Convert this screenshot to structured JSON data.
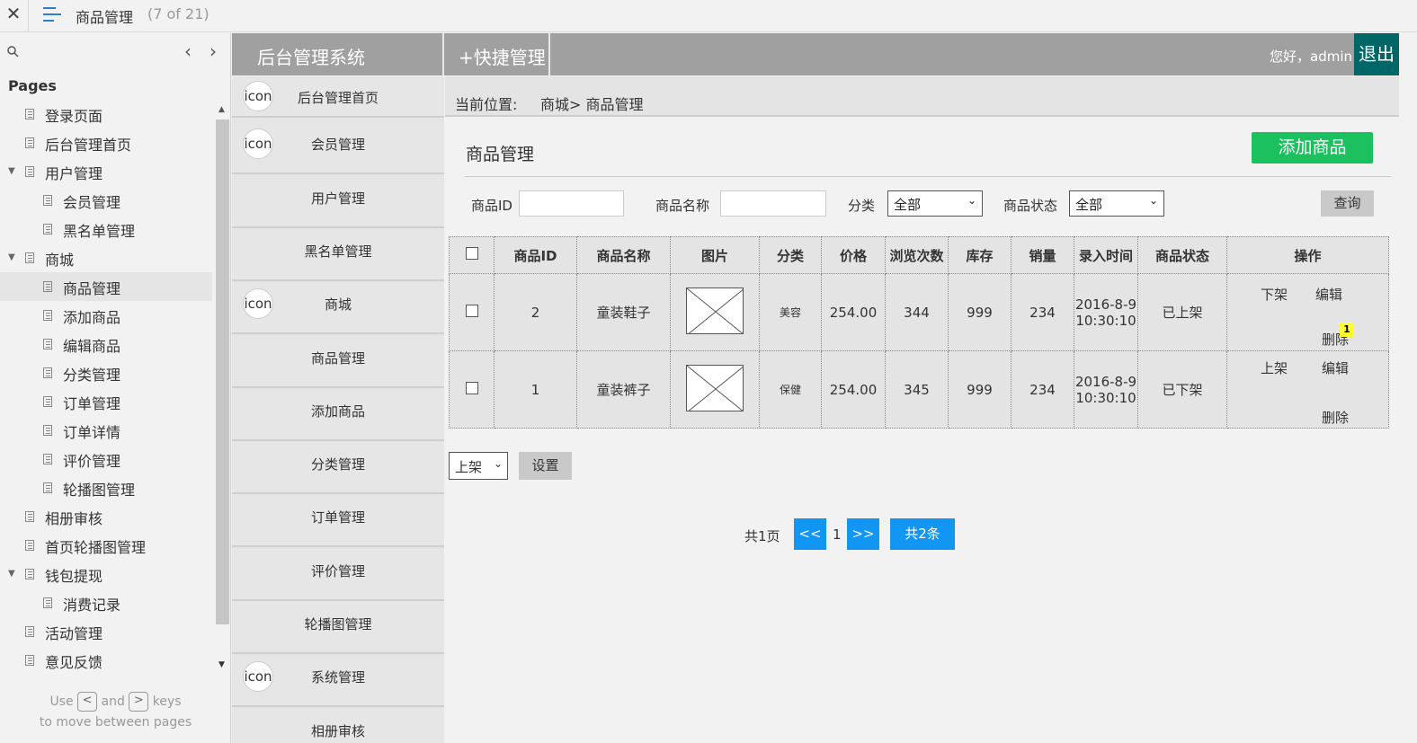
{
  "topbar": {
    "close": "✕",
    "title": "商品管理",
    "count": "(7 of 21)"
  },
  "sidebar": {
    "prev": "‹",
    "next": "›",
    "heading": "Pages",
    "items": [
      {
        "label": "登录页面",
        "level": 1,
        "expand": false
      },
      {
        "label": "后台管理首页",
        "level": 1,
        "expand": false
      },
      {
        "label": "用户管理",
        "level": 1,
        "expand": true
      },
      {
        "label": "会员管理",
        "level": 2,
        "expand": false
      },
      {
        "label": "黑名单管理",
        "level": 2,
        "expand": false
      },
      {
        "label": "商城",
        "level": 1,
        "expand": true
      },
      {
        "label": "商品管理",
        "level": 2,
        "expand": false,
        "selected": true
      },
      {
        "label": "添加商品",
        "level": 2,
        "expand": false
      },
      {
        "label": "编辑商品",
        "level": 2,
        "expand": false
      },
      {
        "label": "分类管理",
        "level": 2,
        "expand": false
      },
      {
        "label": "订单管理",
        "level": 2,
        "expand": false
      },
      {
        "label": "订单详情",
        "level": 2,
        "expand": false
      },
      {
        "label": "评价管理",
        "level": 2,
        "expand": false
      },
      {
        "label": "轮播图管理",
        "level": 2,
        "expand": false
      },
      {
        "label": "相册审核",
        "level": 1,
        "expand": false
      },
      {
        "label": "首页轮播图管理",
        "level": 1,
        "expand": false
      },
      {
        "label": "钱包提现",
        "level": 1,
        "expand": true
      },
      {
        "label": "消费记录",
        "level": 2,
        "expand": false
      },
      {
        "label": "活动管理",
        "level": 1,
        "expand": false
      },
      {
        "label": "意见反馈",
        "level": 1,
        "expand": false
      }
    ],
    "hint_use": "Use",
    "hint_and": "and",
    "hint_keys": "keys",
    "hint_line2": "to move between pages",
    "key_prev": "<",
    "key_next": ">"
  },
  "header": {
    "app_title": "后台管理系统",
    "quick": "+快捷管理",
    "greeting": "您好，admin",
    "logout": "退出"
  },
  "sidenav": [
    {
      "label": "后台管理首页",
      "icon": "icon"
    },
    {
      "label": "会员管理",
      "icon": "icon"
    },
    {
      "label": "用户管理",
      "icon": ""
    },
    {
      "label": "黑名单管理",
      "icon": ""
    },
    {
      "label": "商城",
      "icon": "icon"
    },
    {
      "label": "商品管理",
      "icon": ""
    },
    {
      "label": "添加商品",
      "icon": ""
    },
    {
      "label": "分类管理",
      "icon": ""
    },
    {
      "label": "订单管理",
      "icon": ""
    },
    {
      "label": "评价管理",
      "icon": ""
    },
    {
      "label": "轮播图管理",
      "icon": ""
    },
    {
      "label": "系统管理",
      "icon": "icon"
    },
    {
      "label": "相册审核",
      "icon": ""
    }
  ],
  "breadcrumb": {
    "label": "当前位置:",
    "path": "商城> 商品管理"
  },
  "main": {
    "title": "商品管理",
    "add_button": "添加商品",
    "filters": {
      "id_label": "商品ID",
      "name_label": "商品名称",
      "category_label": "分类",
      "category_value": "全部",
      "status_label": "商品状态",
      "status_value": "全部",
      "query": "查询"
    },
    "table": {
      "headers": [
        "商品ID",
        "商品名称",
        "图片",
        "分类",
        "价格",
        "浏览次数",
        "库存",
        "销量",
        "录入时间",
        "商品状态",
        "操作"
      ],
      "rows": [
        {
          "id": "2",
          "name": "童装鞋子",
          "category": "美容",
          "price": "254.00",
          "views": "344",
          "stock": "999",
          "sales": "234",
          "date": "2016-8-9",
          "time": "10:30:10",
          "status": "已上架",
          "op1": "下架",
          "op2": "编辑",
          "op3": "删除",
          "badge": "1"
        },
        {
          "id": "1",
          "name": "童装裤子",
          "category": "保健",
          "price": "254.00",
          "views": "345",
          "stock": "999",
          "sales": "234",
          "date": "2016-8-9",
          "time": "10:30:10",
          "status": "已下架",
          "op1": "上架",
          "op2": "编辑",
          "op3": "删除",
          "badge": ""
        }
      ]
    },
    "bulk_select": "上架",
    "set_button": "设置",
    "pagination": {
      "total_pages": "共1页",
      "prev": "<<",
      "current": "1",
      "next": ">>",
      "total_items": "共2条"
    }
  }
}
